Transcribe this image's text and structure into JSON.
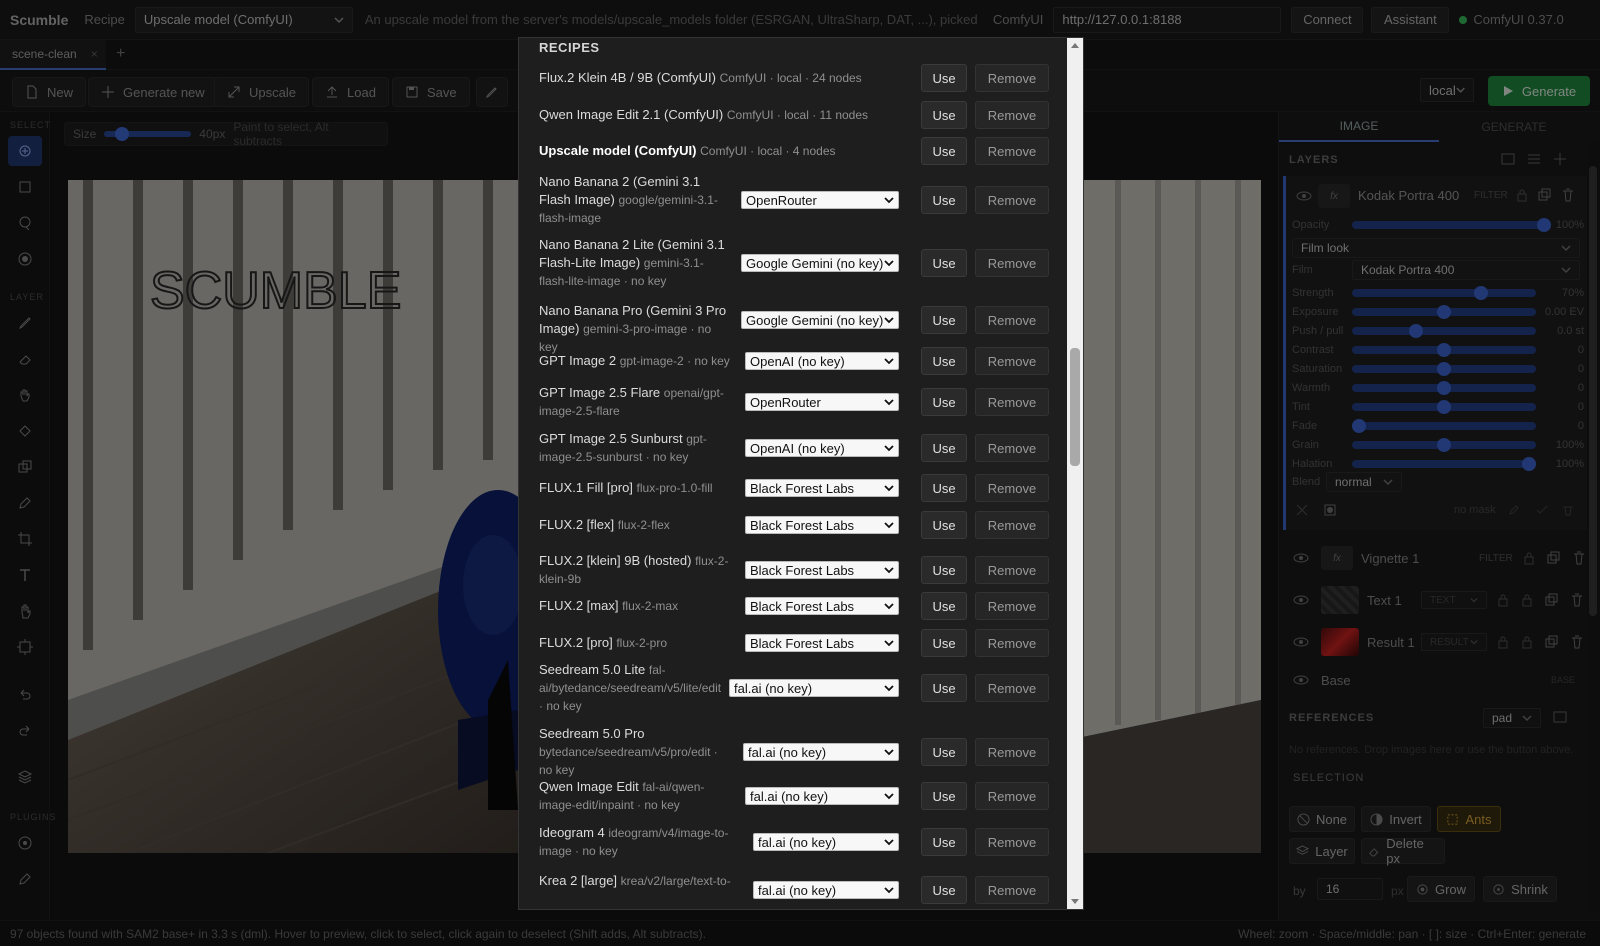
{
  "app": {
    "name": "Scumble",
    "recipe_label": "Recipe",
    "recipe_selected": "Upscale model (ComfyUI)",
    "recipe_description": "An upscale model from the server's models/upscale_models folder (ESRGAN, UltraSharp, DAT, ...), picked ...",
    "backend_label": "ComfyUI",
    "url": "http://127.0.0.1:8188",
    "connect": "Connect",
    "assistant": "Assistant",
    "status": "ComfyUI 0.37.0"
  },
  "tabs": [
    {
      "label": "scene-clean",
      "close": "×"
    }
  ],
  "tab_add": "+",
  "toolbar": {
    "new": "New",
    "generate_new": "Generate new",
    "upscale": "Upscale",
    "load": "Load",
    "save": "Save",
    "backend_select": "local",
    "generate": "Generate"
  },
  "tool_sections": {
    "select": "SELECT",
    "layer": "LAYER",
    "plugins": "PLUGINS"
  },
  "brush": {
    "size_label": "Size",
    "size_value": 40,
    "size_max": 200,
    "size_text": "40px",
    "hint": "Paint to select, Alt subtracts"
  },
  "canvas": {
    "text_overlay": "SCUMBLE"
  },
  "right_panel": {
    "tab_image": "IMAGE",
    "tab_generate": "GENERATE",
    "layers_title": "LAYERS",
    "filter_layer": {
      "name": "Kodak Portra 400",
      "badge": "FILTER",
      "opacity_label": "Opacity",
      "opacity_pct": 100,
      "opacity_value": "100%",
      "look": "Film look",
      "film_label": "Film",
      "film_value": "Kodak Portra 400",
      "sliders": [
        {
          "label": "Strength",
          "value": "70%",
          "level": 0.7
        },
        {
          "label": "Exposure",
          "value": "0.00 EV",
          "level": 0.5
        },
        {
          "label": "Push / pull",
          "value": "0.0 st",
          "level": 0.35
        },
        {
          "label": "Contrast",
          "value": "0",
          "level": 0.5
        },
        {
          "label": "Saturation",
          "value": "0",
          "level": 0.5
        },
        {
          "label": "Warmth",
          "value": "0",
          "level": 0.5
        },
        {
          "label": "Tint",
          "value": "0",
          "level": 0.5
        },
        {
          "label": "Fade",
          "value": "0",
          "level": 0.04
        },
        {
          "label": "Grain",
          "value": "100%",
          "level": 0.5
        },
        {
          "label": "Halation",
          "value": "100%",
          "level": 0.96
        }
      ],
      "blend_label": "Blend",
      "blend_value": "normal",
      "mask_text": "no mask"
    },
    "layers": [
      {
        "name": "Vignette 1",
        "badge": "FILTER"
      },
      {
        "name": "Text 1",
        "badge": "TEXT"
      },
      {
        "name": "Result 1",
        "badge": "RESULT"
      },
      {
        "name": "Base",
        "badge": "BASE"
      }
    ],
    "references_title": "REFERENCES",
    "references_mode": "pad",
    "references_empty": "No references. Drop images here or use the button above.",
    "selection_title": "SELECTION",
    "selection_buttons": [
      "None",
      "Invert",
      "Ants",
      "Layer",
      "Delete px"
    ],
    "by_label": "by",
    "by_value": "16",
    "px_label": "px",
    "grow": "Grow",
    "shrink": "Shrink"
  },
  "status_bar": {
    "left": "97 objects found with SAM2 base+ in 3.3 s (dml). Hover to preview, click to select, click again to deselect (Shift adds, Alt subtracts).",
    "right": "Wheel: zoom · Space/middle: pan · [ ]: size · Ctrl+Enter: generate"
  },
  "modal": {
    "title": "RECIPES",
    "use_label": "Use",
    "remove_label": "Remove",
    "recipes": [
      {
        "name": "Flux.2 Klein 4B / 9B (ComfyUI)",
        "meta": "ComfyUI · local · 24 nodes",
        "provider": ""
      },
      {
        "name": "Qwen Image Edit 2.1 (ComfyUI)",
        "meta": "ComfyUI · local · 11 nodes",
        "provider": ""
      },
      {
        "name": "Upscale model (ComfyUI)",
        "meta": "ComfyUI · local · 4 nodes",
        "provider": ""
      },
      {
        "name": "Nano Banana 2 (Gemini 3.1 Flash Image)",
        "meta": "google/gemini-3.1-flash-image",
        "provider": "OpenRouter"
      },
      {
        "name": "Nano Banana 2 Lite (Gemini 3.1 Flash-Lite Image)",
        "meta": "gemini-3.1-flash-lite-image · no key",
        "provider": "Google Gemini (no key)"
      },
      {
        "name": "Nano Banana Pro (Gemini 3 Pro Image)",
        "meta": "gemini-3-pro-image · no key",
        "provider": "Google Gemini (no key)"
      },
      {
        "name": "GPT Image 2",
        "meta": "gpt-image-2 · no key",
        "provider": "OpenAI (no key)"
      },
      {
        "name": "GPT Image 2.5 Flare",
        "meta": "openai/gpt-image-2.5-flare",
        "provider": "OpenRouter"
      },
      {
        "name": "GPT Image 2.5 Sunburst",
        "meta": "gpt-image-2.5-sunburst · no key",
        "provider": "OpenAI (no key)"
      },
      {
        "name": "FLUX.1 Fill [pro]",
        "meta": "flux-pro-1.0-fill",
        "provider": "Black Forest Labs"
      },
      {
        "name": "FLUX.2 [flex]",
        "meta": "flux-2-flex",
        "provider": "Black Forest Labs"
      },
      {
        "name": "FLUX.2 [klein] 9B (hosted)",
        "meta": "flux-2-klein-9b",
        "provider": "Black Forest Labs"
      },
      {
        "name": "FLUX.2 [max]",
        "meta": "flux-2-max",
        "provider": "Black Forest Labs"
      },
      {
        "name": "FLUX.2 [pro]",
        "meta": "flux-2-pro",
        "provider": "Black Forest Labs"
      },
      {
        "name": "Seedream 5.0 Lite",
        "meta": "fal-ai/bytedance/seedream/v5/lite/edit · no key",
        "provider": "fal.ai (no key)"
      },
      {
        "name": "Seedream 5.0 Pro",
        "meta": "bytedance/seedream/v5/pro/edit · no key",
        "provider": "fal.ai (no key)"
      },
      {
        "name": "Qwen Image Edit",
        "meta": "fal-ai/qwen-image-edit/inpaint · no key",
        "provider": "fal.ai (no key)"
      },
      {
        "name": "Ideogram 4",
        "meta": "ideogram/v4/image-to-image · no key",
        "provider": "fal.ai (no key)"
      },
      {
        "name": "Krea 2 [large]",
        "meta": "krea/v2/large/text-to-",
        "provider": "fal.ai (no key)"
      }
    ]
  }
}
